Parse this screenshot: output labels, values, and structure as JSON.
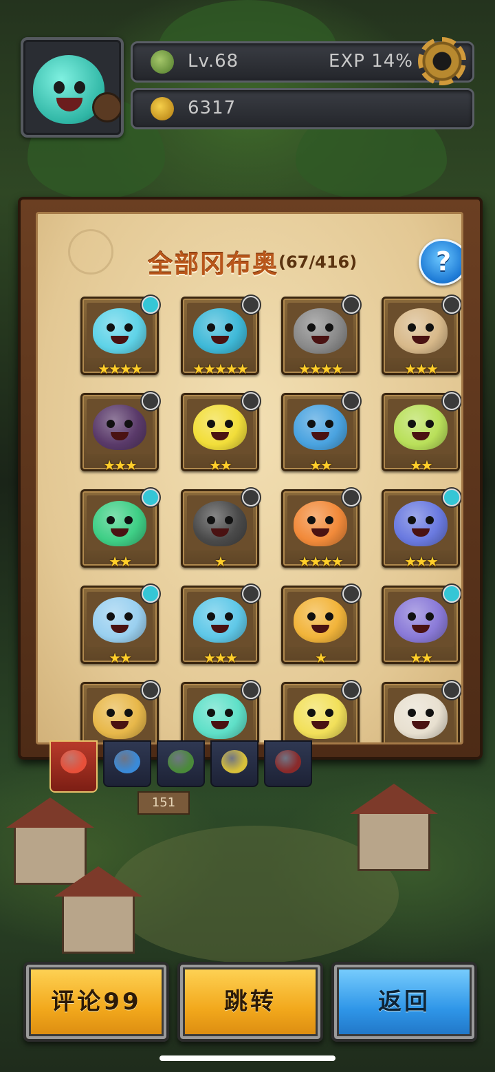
{
  "hud": {
    "level": "Lv.68",
    "exp": "EXP 14%",
    "gold": "6317"
  },
  "board": {
    "title": "全部冈布奥",
    "count": "(67/416)",
    "help": "?"
  },
  "cards": [
    {
      "stars": "★★★★",
      "color": "#5fd3e8",
      "elem": "#35c6d6"
    },
    {
      "stars": "★★★★★",
      "color": "#3fb9d8",
      "elem": "#3a3a3a"
    },
    {
      "stars": "★★★★",
      "color": "#8a8a8a",
      "elem": "#3a3a3a"
    },
    {
      "stars": "★★★",
      "color": "#d8b98a",
      "elem": "#3a3a3a"
    },
    {
      "stars": "★★★",
      "color": "#5a3a6a",
      "elem": "#3a3a3a"
    },
    {
      "stars": "★★",
      "color": "#f2de3a",
      "elem": "#3a3a3a"
    },
    {
      "stars": "★★",
      "color": "#4aa3e0",
      "elem": "#3a3a3a"
    },
    {
      "stars": "★★",
      "color": "#b9e05a",
      "elem": "#3a3a3a"
    },
    {
      "stars": "★★",
      "color": "#3fcf86",
      "elem": "#35c6d6"
    },
    {
      "stars": "★",
      "color": "#4a4a4a",
      "elem": "#3a3a3a"
    },
    {
      "stars": "★★★★",
      "color": "#f28a3a",
      "elem": "#3a3a3a"
    },
    {
      "stars": "★★★",
      "color": "#6a7ae0",
      "elem": "#35c6d6"
    },
    {
      "stars": "★★",
      "color": "#9ad0f0",
      "elem": "#35c6d6"
    },
    {
      "stars": "★★★",
      "color": "#5fc8e8",
      "elem": "#3a3a3a"
    },
    {
      "stars": "★",
      "color": "#f2b43a",
      "elem": "#3a3a3a"
    },
    {
      "stars": "★★",
      "color": "#8a7ad8",
      "elem": "#35c6d6"
    },
    {
      "stars": "",
      "color": "#e8b84a",
      "elem": "#3a3a3a"
    },
    {
      "stars": "",
      "color": "#5fe0c8",
      "elem": "#3a3a3a"
    },
    {
      "stars": "",
      "color": "#f2e05a",
      "elem": "#3a3a3a"
    },
    {
      "stars": "",
      "color": "#e8e0d0",
      "elem": "#3a3a3a"
    }
  ],
  "tabs": [
    {
      "color": "#e8503a"
    },
    {
      "color": "#3a8ad8"
    },
    {
      "color": "#4a8a3a"
    },
    {
      "color": "#d8c03a"
    },
    {
      "color": "#8a2a2a"
    }
  ],
  "scene": {
    "sign": "151"
  },
  "buttons": {
    "comment": "评论99",
    "jump": "跳转",
    "back": "返回"
  }
}
